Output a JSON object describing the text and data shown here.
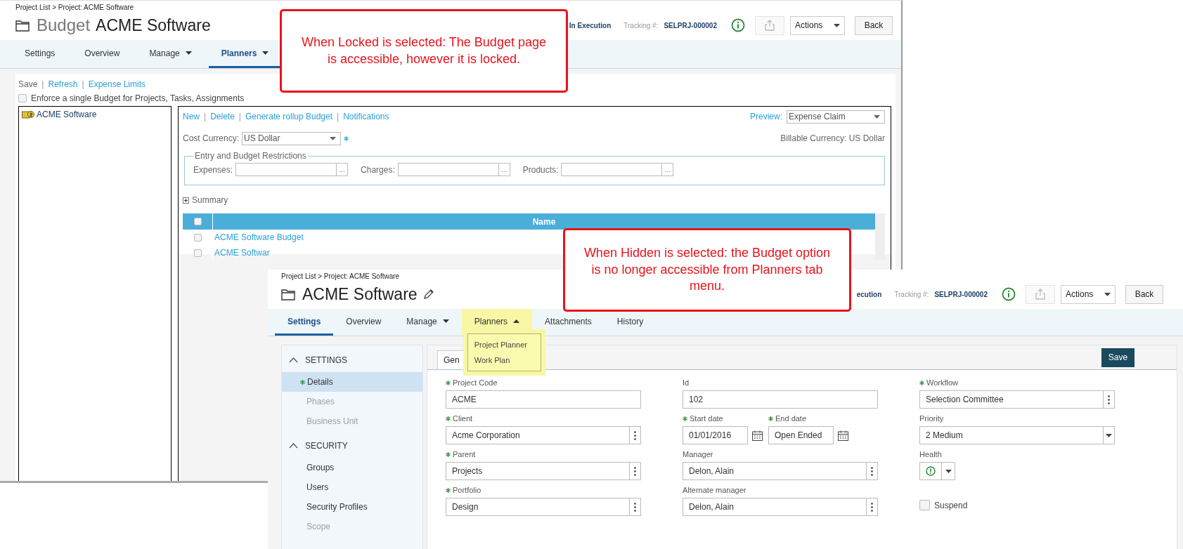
{
  "back_window": {
    "breadcrumb": "Project List > Project: ACME Software",
    "title_prefix": "Budget",
    "title": "ACME Software",
    "status": "In Execution",
    "tracking_label": "Tracking #:",
    "tracking_number": "SELPRJ-000002",
    "actions_label": "Actions",
    "back_label": "Back",
    "tabs": [
      {
        "label": "Settings",
        "selected": false
      },
      {
        "label": "Overview",
        "selected": false
      },
      {
        "label": "Manage",
        "selected": false,
        "expanded": false
      },
      {
        "label": "Planners",
        "selected": true,
        "expanded": false
      }
    ],
    "separator": "|",
    "toolbar_links": [
      {
        "label": "Save",
        "kind": "plain"
      },
      {
        "label": "Refresh",
        "kind": "link"
      },
      {
        "label": "Expense Limits",
        "kind": "link"
      }
    ],
    "enforce_checkbox": {
      "label": "Enforce a single Budget for Projects, Tasks, Assignments",
      "checked": false
    },
    "tree": [
      {
        "label": "ACME Software"
      }
    ],
    "budget_links": [
      "New",
      "Delete",
      "Generate rollup Budget",
      "Notifications"
    ],
    "preview": {
      "label": "Preview:",
      "value": "Expense Claim"
    },
    "cost_currency": {
      "label": "Cost Currency:",
      "value": "US Dollar",
      "required": true
    },
    "billable_currency": "Billable Currency: US Dollar",
    "restrictions": {
      "legend": "Entry and Budget Restrictions",
      "fields": [
        {
          "label": "Expenses:",
          "button": "..."
        },
        {
          "label": "Charges:",
          "button": "..."
        },
        {
          "label": "Products:",
          "button": "..."
        }
      ]
    },
    "summary": {
      "label": "Summary",
      "expanded": false
    },
    "table": {
      "columns": [
        "Name"
      ],
      "all_checked": false,
      "rows": [
        {
          "name": "ACME Software Budget",
          "checked": false
        },
        {
          "name": "ACME Softwar",
          "checked": false
        }
      ]
    }
  },
  "front_window": {
    "breadcrumb": "Project List > Project: ACME Software",
    "title": "ACME Software",
    "status": "ecution",
    "tracking_label": "Tracking #:",
    "tracking_number": "SELPRJ-000002",
    "actions_label": "Actions",
    "back_label": "Back",
    "tabs": [
      {
        "label": "Settings",
        "selected": true
      },
      {
        "label": "Overview",
        "selected": false
      },
      {
        "label": "Manage",
        "selected": false,
        "expanded": false
      },
      {
        "label": "Planners",
        "selected": false,
        "expanded": true,
        "menu_items": [
          "Project Planner",
          "Work Plan"
        ]
      },
      {
        "label": "Attachments",
        "selected": false
      },
      {
        "label": "History",
        "selected": false
      }
    ],
    "sidebar": [
      {
        "title": "SETTINGS",
        "expanded": true,
        "items": [
          {
            "label": "Details",
            "selected": true,
            "disabled": false,
            "required": true
          },
          {
            "label": "Phases",
            "selected": false,
            "disabled": true,
            "required": false
          },
          {
            "label": "Business Unit",
            "selected": false,
            "disabled": true,
            "required": false
          }
        ]
      },
      {
        "title": "SECURITY",
        "expanded": true,
        "items": [
          {
            "label": "Groups",
            "selected": false,
            "disabled": false,
            "required": false
          },
          {
            "label": "Users",
            "selected": false,
            "disabled": false,
            "required": false
          },
          {
            "label": "Security Profiles",
            "selected": false,
            "disabled": false,
            "required": false
          },
          {
            "label": "Scope",
            "selected": false,
            "disabled": true,
            "required": false
          }
        ]
      }
    ],
    "form_tab": "Gen",
    "save_label": "Save",
    "form": [
      [
        {
          "kind": "text",
          "label": "Project Code",
          "required": true,
          "value": "ACME"
        },
        {
          "kind": "text",
          "label": "Id",
          "required": false,
          "value": "102"
        },
        {
          "kind": "picker",
          "label": "Workflow",
          "required": true,
          "value": "Selection Committee"
        }
      ],
      [
        {
          "kind": "picker",
          "label": "Client",
          "required": true,
          "value": "Acme Corporation"
        },
        {
          "kind": "dates",
          "items": [
            {
              "label": "Start date",
              "required": true,
              "value": "01/01/2016"
            },
            {
              "label": "End date",
              "required": true,
              "value": "Open Ended"
            }
          ]
        },
        {
          "kind": "select",
          "label": "Priority",
          "required": false,
          "value": "2 Medium"
        }
      ],
      [
        {
          "kind": "picker",
          "label": "Parent",
          "required": true,
          "value": "Projects"
        },
        {
          "kind": "picker",
          "label": "Manager",
          "required": false,
          "value": "Delon, Alain"
        },
        {
          "kind": "health",
          "label": "Health",
          "required": false
        }
      ],
      [
        {
          "kind": "picker",
          "label": "Portfolio",
          "required": true,
          "value": "Design"
        },
        {
          "kind": "picker",
          "label": "Alternate manager",
          "required": false,
          "value": "Delon, Alain"
        },
        {
          "kind": "checkbox",
          "label": "Suspend",
          "checked": false
        }
      ]
    ]
  },
  "callouts": [
    {
      "text": "When Locked is selected: The Budget page is accessible, however it is locked."
    },
    {
      "text": "When Hidden is selected: the Budget option is no longer accessible from Planners tab menu."
    }
  ]
}
